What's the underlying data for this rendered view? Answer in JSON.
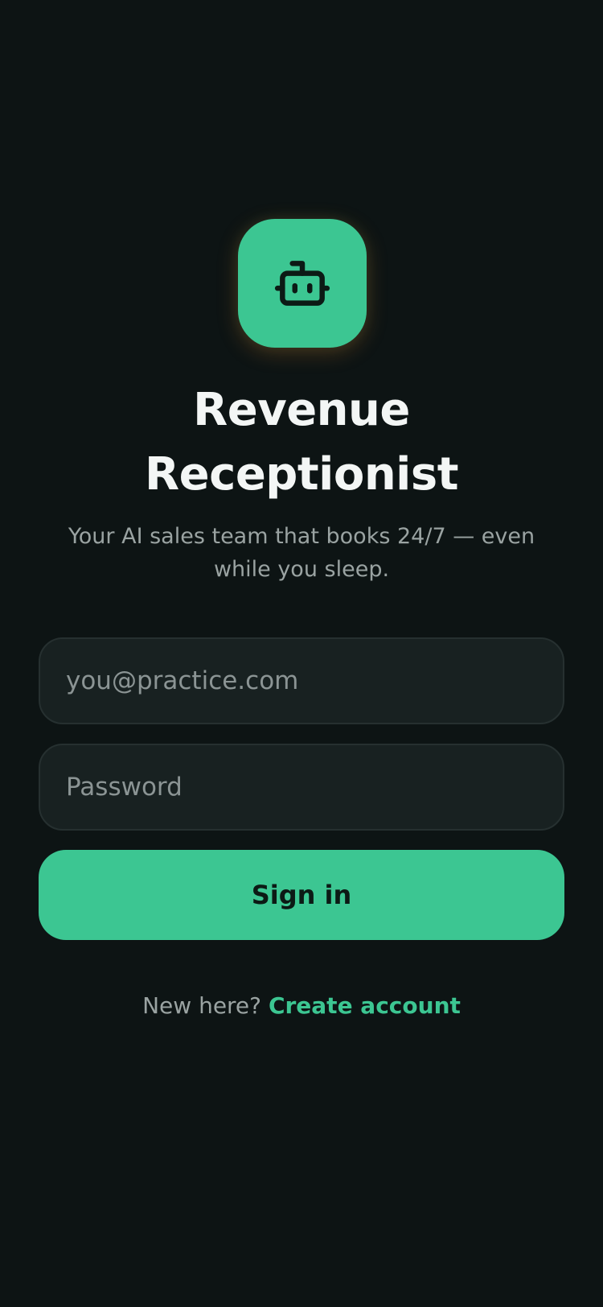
{
  "app": {
    "title_line1": "Revenue",
    "title_line2": "Receptionist",
    "tagline": "Your AI sales team that books 24/7 — even while you sleep.",
    "logo_icon": "robot-icon"
  },
  "form": {
    "email_placeholder": "you@practice.com",
    "password_placeholder": "Password",
    "submit_label": "Sign in"
  },
  "signup": {
    "prompt": "New here?",
    "link_label": "Create account"
  },
  "colors": {
    "background": "#0d1414",
    "accent": "#3cc692",
    "field_background": "#182121",
    "title_text": "#f3f6f5",
    "muted_text": "#9aa3a2"
  }
}
